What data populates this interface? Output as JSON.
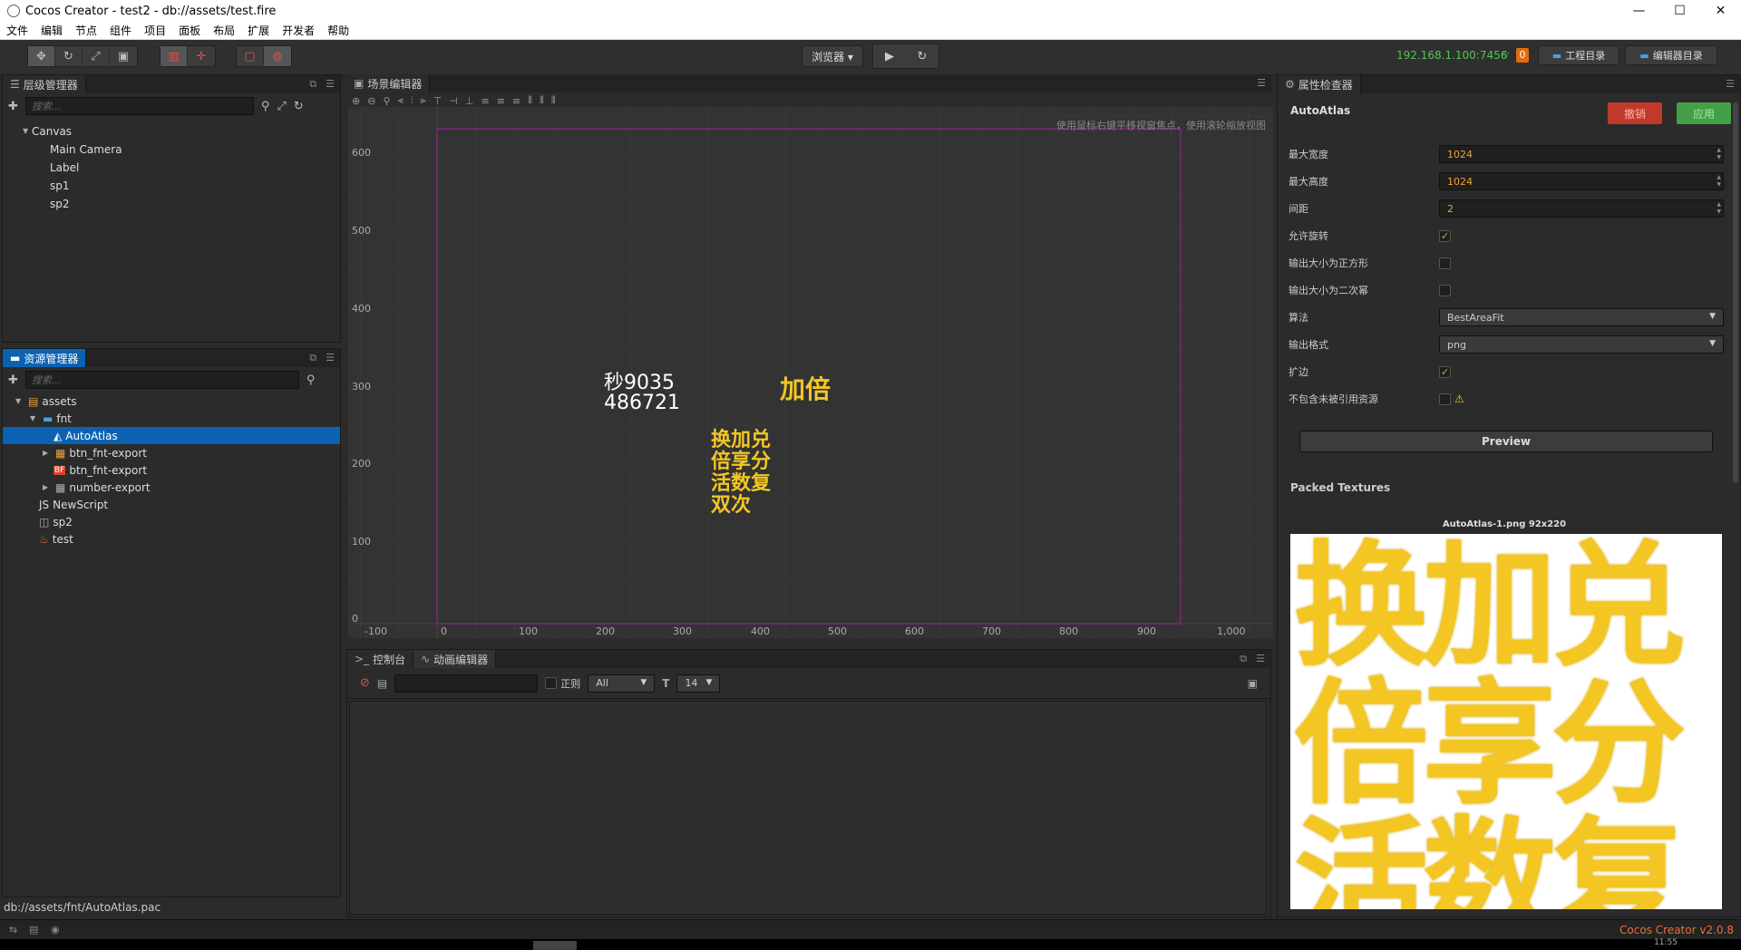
{
  "window": {
    "title": "Cocos Creator - test2 - db://assets/test.fire",
    "controls": [
      "—",
      "☐",
      "✕"
    ]
  },
  "menu": [
    "文件",
    "编辑",
    "节点",
    "组件",
    "项目",
    "面板",
    "布局",
    "扩展",
    "开发者",
    "帮助"
  ],
  "toolbar": {
    "browser_label": "浏览器 ▾",
    "ip": "192.168.1.100:7456",
    "badge": "0",
    "project_dir": "工程目录",
    "editor_dir": "编辑器目录"
  },
  "hierarchy": {
    "tab": "层级管理器",
    "search_placeholder": "搜索...",
    "nodes": [
      "Canvas",
      "Main Camera",
      "Label",
      "sp1",
      "sp2"
    ]
  },
  "assets": {
    "tab": "资源管理器",
    "search_placeholder": "搜索...",
    "items": [
      "assets",
      "fnt",
      "AutoAtlas",
      "btn_fnt-export",
      "btn_fnt-export",
      "number-export",
      "NewScript",
      "sp2",
      "test"
    ],
    "path": "db://assets/fnt/AutoAtlas.pac"
  },
  "scene": {
    "tab": "场景编辑器",
    "hint": "使用鼠标右键平移视窗焦点，使用滚轮缩放视图",
    "y_ticks": [
      "600",
      "500",
      "400",
      "300",
      "200",
      "100",
      "0"
    ],
    "x_ticks": [
      "-100",
      "0",
      "100",
      "200",
      "300",
      "400",
      "500",
      "600",
      "700",
      "800",
      "900",
      "1,000"
    ],
    "label_white_1": "秒9035",
    "label_white_2": "486721",
    "label_yellow_top": "加倍",
    "label_yellow_lines": [
      "换加兑",
      "倍享分",
      "活数复",
      "双次"
    ]
  },
  "console": {
    "tab_console": "控制台",
    "tab_anim": "动画编辑器",
    "regex_label": "正则",
    "filter_value": "All",
    "font_size": "14"
  },
  "inspector": {
    "tab": "属性检查器",
    "asset_name": "AutoAtlas",
    "revert": "撤销",
    "apply": "应用",
    "max_width_label": "最大宽度",
    "max_width": "1024",
    "max_height_label": "最大高度",
    "max_height": "1024",
    "padding_label": "间距",
    "padding": "2",
    "allow_rotation_label": "允许旋转",
    "square_label": "输出大小为正方形",
    "pot_label": "输出大小为二次幂",
    "algorithm_label": "算法",
    "algorithm": "BestAreaFit",
    "format_label": "输出格式",
    "format": "png",
    "extrude_label": "扩边",
    "unused_label": "不包含未被引用资源",
    "preview_button": "Preview",
    "packed_label": "Packed Textures",
    "texture_caption": "AutoAtlas-1.png 92x220",
    "texture_lines": [
      "换加兑",
      "倍享分",
      "活数复"
    ]
  },
  "status": {
    "version": "Cocos Creator v2.0.8",
    "clock": "11:55"
  },
  "colors": {
    "accent_blue": "#0b62b0",
    "orange": "#e8a33a",
    "green": "#4ec94e",
    "revert_red": "#c0392b",
    "apply_green": "#43a047",
    "gold": "#f3c623"
  }
}
